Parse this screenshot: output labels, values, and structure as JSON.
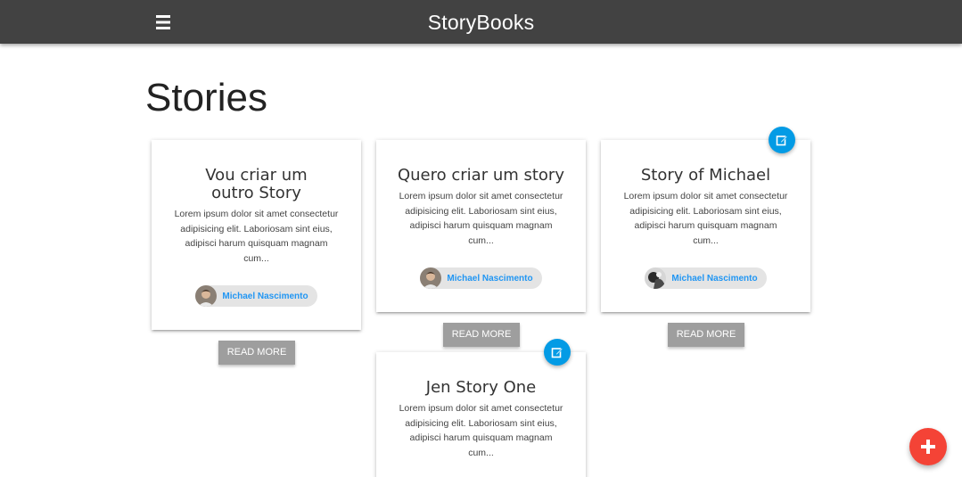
{
  "navbar": {
    "brand": "StoryBooks",
    "menu_icon": "hamburger-menu-icon",
    "background": "#424242"
  },
  "page": {
    "title": "Stories"
  },
  "stories": [
    {
      "title": "Vou criar um outro Story",
      "excerpt": "Lorem ipsum dolor sit amet consectetur adipisicing elit. Laboriosam sint eius, adipisci harum quisquam magnam cum...",
      "author": "Michael Nascimento",
      "read_more": "READ MORE",
      "editable": false
    },
    {
      "title": "Quero criar um story",
      "excerpt": "Lorem ipsum dolor sit amet consectetur adipisicing elit. Laboriosam sint eius, adipisci harum quisquam magnam cum...",
      "author": "Michael Nascimento",
      "read_more": "READ MORE",
      "editable": false
    },
    {
      "title": "Story of Michael",
      "excerpt": "Lorem ipsum dolor sit amet consectetur adipisicing elit. Laboriosam sint eius, adipisci harum quisquam magnam cum...",
      "author": "Michael Nascimento",
      "read_more": "READ MORE",
      "editable": true
    },
    {
      "title": "Jen Story One",
      "excerpt": "Lorem ipsum dolor sit amet consectetur adipisicing elit. Laboriosam sint eius, adipisci harum quisquam magnam cum...",
      "editable": true
    }
  ],
  "colors": {
    "accent_blue": "#039be5",
    "author_link": "#2196f3",
    "fab_red": "#f44336",
    "button_grey": "#9e9e9e"
  },
  "icons": {
    "edit": "edit-pencil-icon",
    "add": "add-plus-icon"
  }
}
